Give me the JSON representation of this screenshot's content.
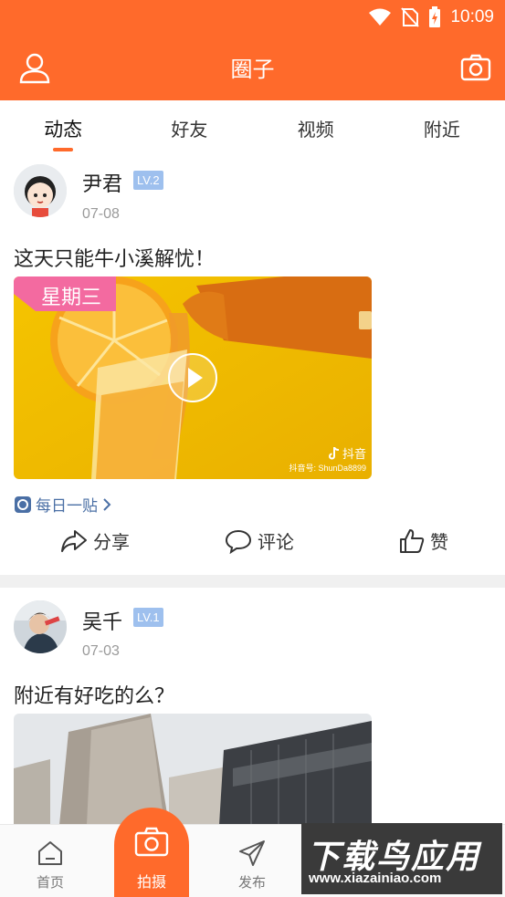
{
  "status_bar": {
    "time": "10:09"
  },
  "header": {
    "title": "圈子"
  },
  "tabs": [
    {
      "label": "动态",
      "active": true
    },
    {
      "label": "好友",
      "active": false
    },
    {
      "label": "视频",
      "active": false
    },
    {
      "label": "附近",
      "active": false
    }
  ],
  "posts": [
    {
      "username": "尹君",
      "level": "LV.2",
      "date": "07-08",
      "content": "这天只能牛小溪解忧！",
      "media": {
        "badge": "星期三",
        "source_name": "抖音",
        "source_id": "抖音号: ShunDa8899"
      },
      "tag": "每日一贴",
      "actions": {
        "share": "分享",
        "comment": "评论",
        "like": "赞"
      }
    },
    {
      "username": "吴千",
      "level": "LV.1",
      "date": "07-03",
      "content": "附近有好吃的么？"
    }
  ],
  "bottom_nav": {
    "home": "首页",
    "shoot": "拍摄",
    "publish": "发布"
  },
  "watermark": {
    "title": "下载鸟应用",
    "url": "www.xiazainiao.com"
  },
  "colors": {
    "accent": "#ff6a2b",
    "level_badge": "#9ec0ee",
    "link": "#4a6fa5"
  }
}
